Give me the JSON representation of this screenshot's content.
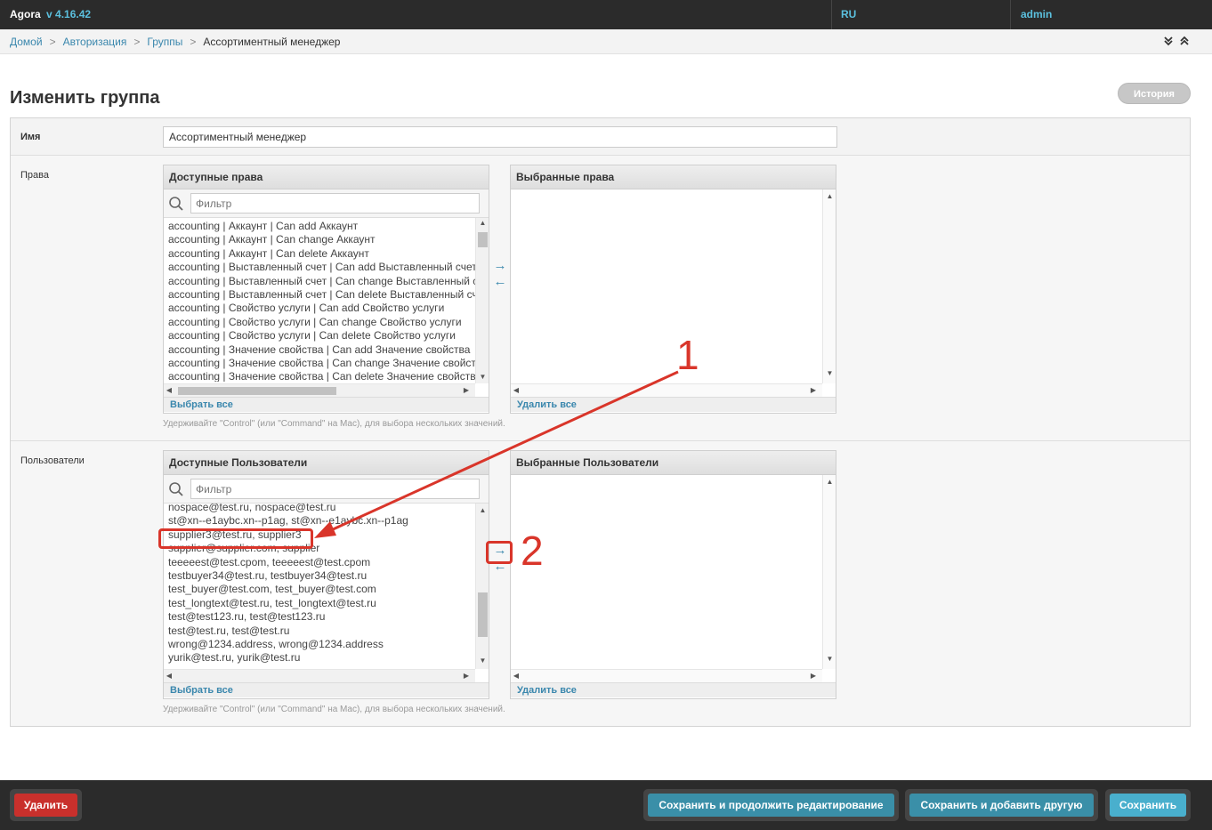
{
  "header": {
    "app_name": "Agora",
    "version": "v 4.16.42",
    "language": "RU",
    "user": "admin"
  },
  "breadcrumb": {
    "items": [
      "Домой",
      "Авторизация",
      "Группы"
    ],
    "current": "Ассортиментный менеджер"
  },
  "page": {
    "title": "Изменить группа",
    "history_label": "История"
  },
  "fields": {
    "name": {
      "label": "Имя",
      "value": "Ассортиментный менеджер"
    },
    "permissions": {
      "label": "Права",
      "available_title": "Доступные права",
      "chosen_title": "Выбранные права",
      "filter_placeholder": "Фильтр",
      "items": [
        "accounting | Аккаунт | Can add Аккаунт",
        "accounting | Аккаунт | Can change Аккаунт",
        "accounting | Аккаунт | Can delete Аккаунт",
        "accounting | Выставленный счет | Can add Выставленный счет",
        "accounting | Выставленный счет | Can change Выставленный счет",
        "accounting | Выставленный счет | Can delete Выставленный счет",
        "accounting | Свойство услуги | Can add Свойство услуги",
        "accounting | Свойство услуги | Can change Свойство услуги",
        "accounting | Свойство услуги | Can delete Свойство услуги",
        "accounting | Значение свойства | Can add Значение свойства",
        "accounting | Значение свойства | Can change Значение свойства",
        "accounting | Значение свойства | Can delete Значение свойства"
      ],
      "choose_all": "Выбрать все",
      "remove_all": "Удалить все",
      "help": "Удерживайте \"Control\" (или \"Command\" на Mac), для выбора нескольких значений."
    },
    "users": {
      "label": "Пользователи",
      "available_title": "Доступные Пользователи",
      "chosen_title": "Выбранные Пользователи",
      "filter_placeholder": "Фильтр",
      "items": [
        "nospace@test.ru, nospace@test.ru",
        "st@xn--e1aybc.xn--p1ag, st@xn--e1aybc.xn--p1ag",
        "supplier3@test.ru, supplier3",
        "supplier@supplier.com, supplier",
        "teeeeest@test.cpom, teeeeest@test.cpom",
        "testbuyer34@test.ru, testbuyer34@test.ru",
        "test_buyer@test.com, test_buyer@test.com",
        "test_longtext@test.ru, test_longtext@test.ru",
        "test@test123.ru, test@test123.ru",
        "test@test.ru, test@test.ru",
        "wrong@1234.address, wrong@1234.address",
        "yurik@test.ru, yurik@test.ru"
      ],
      "choose_all": "Выбрать все",
      "remove_all": "Удалить все",
      "help": "Удерживайте \"Control\" (или \"Command\" на Mac), для выбора нескольких значений."
    }
  },
  "annotations": {
    "step1": "1",
    "step2": "2"
  },
  "actions": {
    "delete": "Удалить",
    "save_continue": "Сохранить и продолжить редактирование",
    "save_add": "Сохранить и добавить другую",
    "save": "Сохранить"
  },
  "colors": {
    "link": "#3a87ad",
    "save": "#49afcd",
    "delete": "#d9534f",
    "annotation": "#d9352a",
    "header_bg": "#2b2b2b"
  }
}
